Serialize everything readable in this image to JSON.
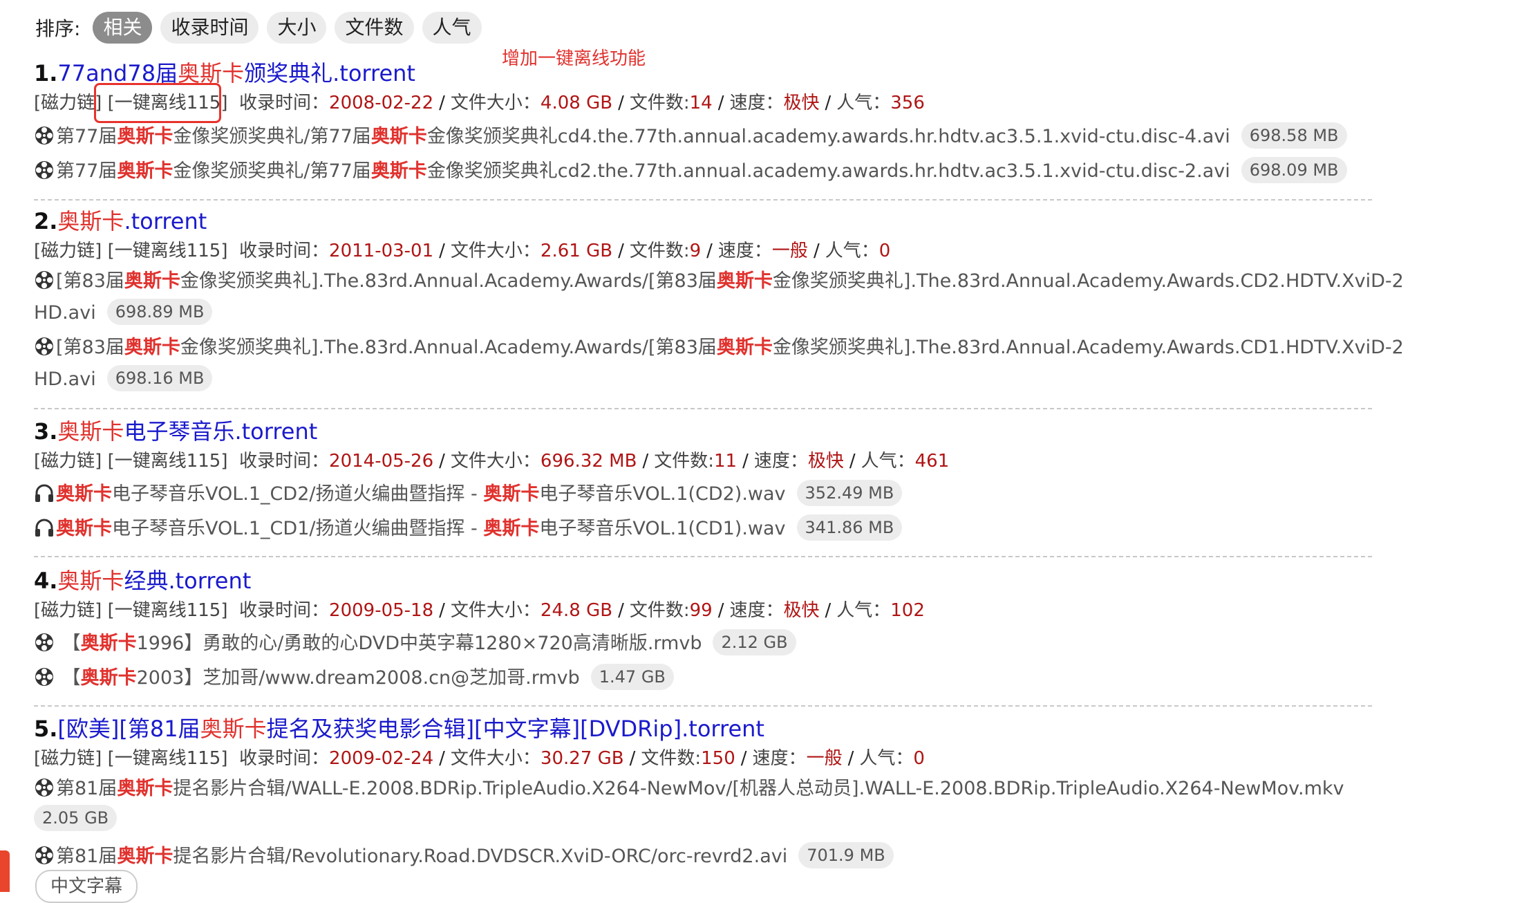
{
  "sort": {
    "label": "排序:",
    "options": [
      "相关",
      "收录时间",
      "大小",
      "文件数",
      "人气"
    ],
    "active": "相关"
  },
  "annotation": "增加一键离线功能",
  "results": [
    {
      "num": "1.",
      "title_pre": "77and78届",
      "title_hl": "奥斯卡",
      "title_post": "颁奖典礼.torrent",
      "magnet": "[磁力链]",
      "offline": "[一键离线115]",
      "date_label": "收录时间：",
      "date": "2008-02-22",
      "size_label": "文件大小：",
      "size": "4.08 GB",
      "count_label": "文件数:",
      "count": "14",
      "speed_label": "速度：",
      "speed": "极快",
      "pop_label": "人气：",
      "pop": "356",
      "files": [
        {
          "icon": "film-reel-icon",
          "a": "第77届",
          "b": "奥斯卡",
          "c": "金像奖颁奖典礼/第77届",
          "d": "奥斯卡",
          "e": "金像奖颁奖典礼cd4.the.77th.annual.academy.awards.hr.hdtv.ac3.5.1.xvid-ctu.disc-4.avi",
          "size": "698.58 MB"
        },
        {
          "icon": "film-reel-icon",
          "a": "第77届",
          "b": "奥斯卡",
          "c": "金像奖颁奖典礼/第77届",
          "d": "奥斯卡",
          "e": "金像奖颁奖典礼cd2.the.77th.annual.academy.awards.hr.hdtv.ac3.5.1.xvid-ctu.disc-2.avi",
          "size": "698.09 MB"
        }
      ]
    },
    {
      "num": "2.",
      "title_pre": "",
      "title_hl": "奥斯卡",
      "title_post": ".torrent",
      "magnet": "[磁力链]",
      "offline": "[一键离线115]",
      "date_label": "收录时间：",
      "date": "2011-03-01",
      "size_label": "文件大小：",
      "size": "2.61 GB",
      "count_label": "文件数:",
      "count": "9",
      "speed_label": "速度：",
      "speed": "一般",
      "pop_label": "人气：",
      "pop": "0",
      "files": [
        {
          "icon": "film-reel-icon",
          "a": "[第83届",
          "b": "奥斯卡",
          "c": "金像奖颁奖典礼].The.83rd.Annual.Academy.Awards/[第83届",
          "d": "奥斯卡",
          "e": "金像奖颁奖典礼].The.83rd.Annual.Academy.Awards.CD2.HDTV.XviD-2",
          "f": "HD.avi",
          "size": "698.89 MB"
        },
        {
          "icon": "film-reel-icon",
          "a": "[第83届",
          "b": "奥斯卡",
          "c": "金像奖颁奖典礼].The.83rd.Annual.Academy.Awards/[第83届",
          "d": "奥斯卡",
          "e": "金像奖颁奖典礼].The.83rd.Annual.Academy.Awards.CD1.HDTV.XviD-2",
          "f": "HD.avi",
          "size": "698.16 MB"
        }
      ]
    },
    {
      "num": "3.",
      "title_pre": "",
      "title_hl": "奥斯卡",
      "title_post": "电子琴音乐.torrent",
      "magnet": "[磁力链]",
      "offline": "[一键离线115]",
      "date_label": "收录时间：",
      "date": "2014-05-26",
      "size_label": "文件大小：",
      "size": "696.32 MB",
      "count_label": "文件数:",
      "count": "11",
      "speed_label": "速度：",
      "speed": "极快",
      "pop_label": "人气：",
      "pop": "461",
      "files": [
        {
          "icon": "headphones-icon",
          "a": "",
          "b": "奥斯卡",
          "c": "电子琴音乐VOL.1_CD2/扬道火编曲暨指挥 - ",
          "d": "奥斯卡",
          "e": "电子琴音乐VOL.1(CD2).wav",
          "size": "352.49 MB"
        },
        {
          "icon": "headphones-icon",
          "a": "",
          "b": "奥斯卡",
          "c": "电子琴音乐VOL.1_CD1/扬道火编曲暨指挥 - ",
          "d": "奥斯卡",
          "e": "电子琴音乐VOL.1(CD1).wav",
          "size": "341.86 MB"
        }
      ]
    },
    {
      "num": "4.",
      "title_pre": "",
      "title_hl": "奥斯卡",
      "title_post": "经典.torrent",
      "magnet": "[磁力链]",
      "offline": "[一键离线115]",
      "date_label": "收录时间：",
      "date": "2009-05-18",
      "size_label": "文件大小：",
      "size": "24.8 GB",
      "count_label": "文件数:",
      "count": "99",
      "speed_label": "速度：",
      "speed": "极快",
      "pop_label": "人气：",
      "pop": "102",
      "files": [
        {
          "icon": "film-reel-icon",
          "a": "【",
          "b": "奥斯卡",
          "c": "1996】勇敢的心/勇敢的心DVD中英字幕1280×720高清晰版.rmvb",
          "d": "",
          "e": "",
          "size": "2.12 GB"
        },
        {
          "icon": "film-reel-icon",
          "a": "【",
          "b": "奥斯卡",
          "c": "2003】芝加哥/www.dream2008.cn@芝加哥.rmvb",
          "d": "",
          "e": "",
          "size": "1.47 GB"
        }
      ]
    },
    {
      "num": "5.",
      "title_pre": "[欧美][第81届",
      "title_hl": "奥斯卡",
      "title_post": "提名及获奖电影合辑][中文字幕][DVDRip].torrent",
      "magnet": "[磁力链]",
      "offline": "[一键离线115]",
      "date_label": "收录时间：",
      "date": "2009-02-24",
      "size_label": "文件大小：",
      "size": "30.27 GB",
      "count_label": "文件数:",
      "count": "150",
      "speed_label": "速度：",
      "speed": "一般",
      "pop_label": "人气：",
      "pop": "0",
      "files": [
        {
          "icon": "film-reel-icon",
          "a": "第81届",
          "b": "奥斯卡",
          "c": "提名影片合辑/WALL-E.2008.BDRip.TripleAudio.X264-NewMov/[机器人总动员].WALL-E.2008.BDRip.TripleAudio.X264-NewMov.mkv",
          "d": "",
          "e": "",
          "size": "2.05 GB"
        },
        {
          "icon": "film-reel-icon",
          "a": "第81届",
          "b": "奥斯卡",
          "c": "提名影片合辑/Revolutionary.Road.DVDSCR.XviD-ORC/orc-revrd2.avi",
          "d": "",
          "e": "",
          "size": "701.9 MB"
        }
      ],
      "tag": "中文字幕"
    }
  ]
}
